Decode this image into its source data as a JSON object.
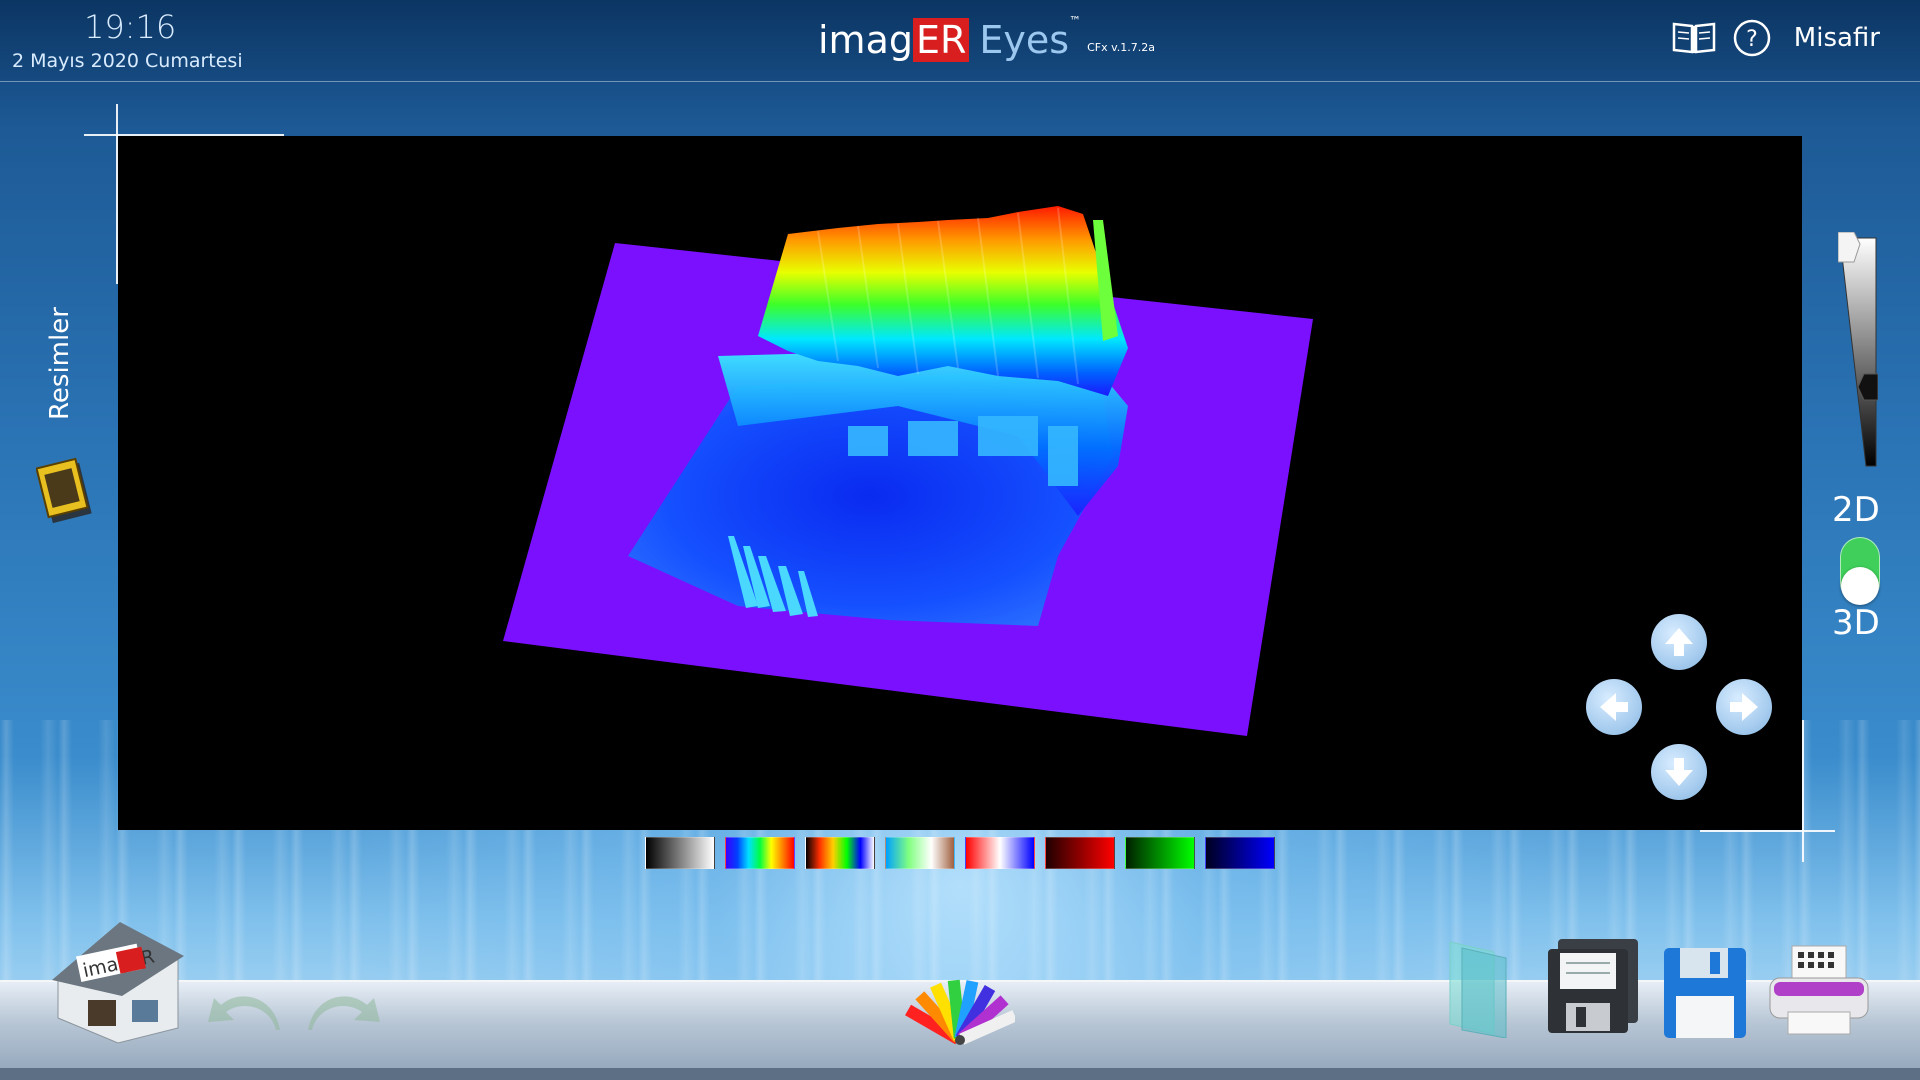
{
  "header": {
    "time": "19:16",
    "date": "2 Mayıs 2020 Cumartesi",
    "brand_part1": "imag",
    "brand_part2": "ER",
    "brand_part3": "Eyes",
    "brand_tm": "™",
    "version": "CFx v.1.7.2a",
    "user": "Misafir",
    "icons": [
      "book-icon",
      "help-icon"
    ]
  },
  "sidebar": {
    "label": "Resimler",
    "thumbnail_icon": "images-thumbnail-icon"
  },
  "view_mode": {
    "label_2d": "2D",
    "label_3d": "3D",
    "selected": "3D"
  },
  "level_slider": {
    "value": 0.65
  },
  "palettes": [
    {
      "name": "grayscale",
      "colors": [
        "#000000",
        "#ffffff"
      ]
    },
    {
      "name": "rainbow",
      "colors": [
        "#3a00ff",
        "#0040ff",
        "#00e0ff",
        "#00ff40",
        "#ffff00",
        "#ff8000",
        "#ff0000"
      ]
    },
    {
      "name": "spectrum-bands",
      "colors": [
        "#000000",
        "#ff3000",
        "#ffd000",
        "#00ff00",
        "#0000ff",
        "#ffffff"
      ]
    },
    {
      "name": "earth",
      "colors": [
        "#00a0ff",
        "#80ff80",
        "#ffffff",
        "#a06040"
      ]
    },
    {
      "name": "red-white-blue",
      "colors": [
        "#ff0000",
        "#ffffff",
        "#0000ff"
      ]
    },
    {
      "name": "dark-red",
      "colors": [
        "#200000",
        "#ff0000"
      ]
    },
    {
      "name": "green",
      "colors": [
        "#002000",
        "#00ff00"
      ]
    },
    {
      "name": "blue",
      "colors": [
        "#000020",
        "#0000ff"
      ]
    }
  ],
  "dock": {
    "home_label": "imagER"
  },
  "colors": {
    "accent_red": "#d81e1e",
    "toggle_green": "#3fcf5a",
    "surface_violet": "#7b10ff"
  }
}
